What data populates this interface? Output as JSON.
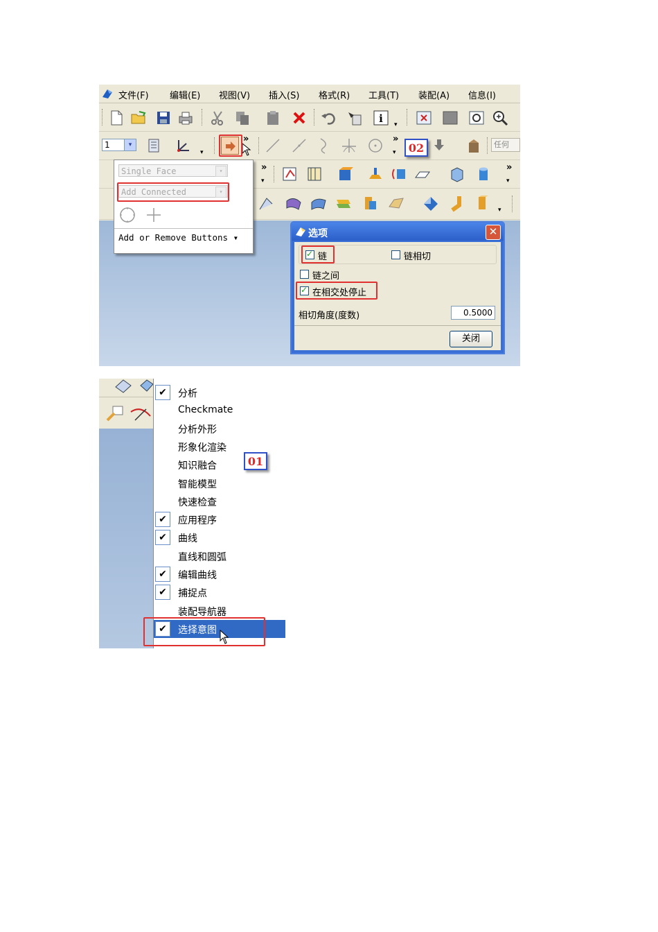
{
  "menubar": {
    "items": [
      "文件(F)",
      "编辑(E)",
      "视图(V)",
      "插入(S)",
      "格式(R)",
      "工具(T)",
      "装配(A)",
      "信息(I)"
    ]
  },
  "toolbar": {
    "layer_value": "1",
    "search_placeholder": "任何"
  },
  "selection_popup": {
    "face_rule": "Single Face",
    "curve_rule": "Add Connected",
    "add_remove": "Add or Remove Buttons"
  },
  "options_dialog": {
    "title": "选项",
    "close_glyph": "✕",
    "chain_label": "链",
    "chain_checked": true,
    "chain_tangent_label": "链相切",
    "chain_tangent_checked": false,
    "between_label": "链之间",
    "between_checked": false,
    "stop_at_intersection_label": "在相交处停止",
    "stop_at_intersection_checked": true,
    "tangent_angle_label": "相切角度(度数)",
    "tangent_angle_value": "0.5000",
    "close_button": "关闭"
  },
  "badges": {
    "top": "02",
    "bottom": "01"
  },
  "toolbar_menu": {
    "items": [
      {
        "label": "分析",
        "checked": true
      },
      {
        "label": "Checkmate",
        "checked": false
      },
      {
        "label": "分析外形",
        "checked": false
      },
      {
        "label": "形象化渲染",
        "checked": false
      },
      {
        "label": "知识融合",
        "checked": false
      },
      {
        "label": "智能模型",
        "checked": false
      },
      {
        "label": "快速检查",
        "checked": false
      },
      {
        "label": "应用程序",
        "checked": true
      },
      {
        "label": "曲线",
        "checked": true
      },
      {
        "label": "直线和圆弧",
        "checked": false
      },
      {
        "label": "编辑曲线",
        "checked": true
      },
      {
        "label": "捕捉点",
        "checked": true
      },
      {
        "label": "装配导航器",
        "checked": false
      },
      {
        "label": "选择意图",
        "checked": true,
        "selected": true
      }
    ]
  },
  "colors": {
    "highlight": "#316ac5",
    "annotation_red": "#e03030",
    "xp_title": "#2c5fc9"
  }
}
